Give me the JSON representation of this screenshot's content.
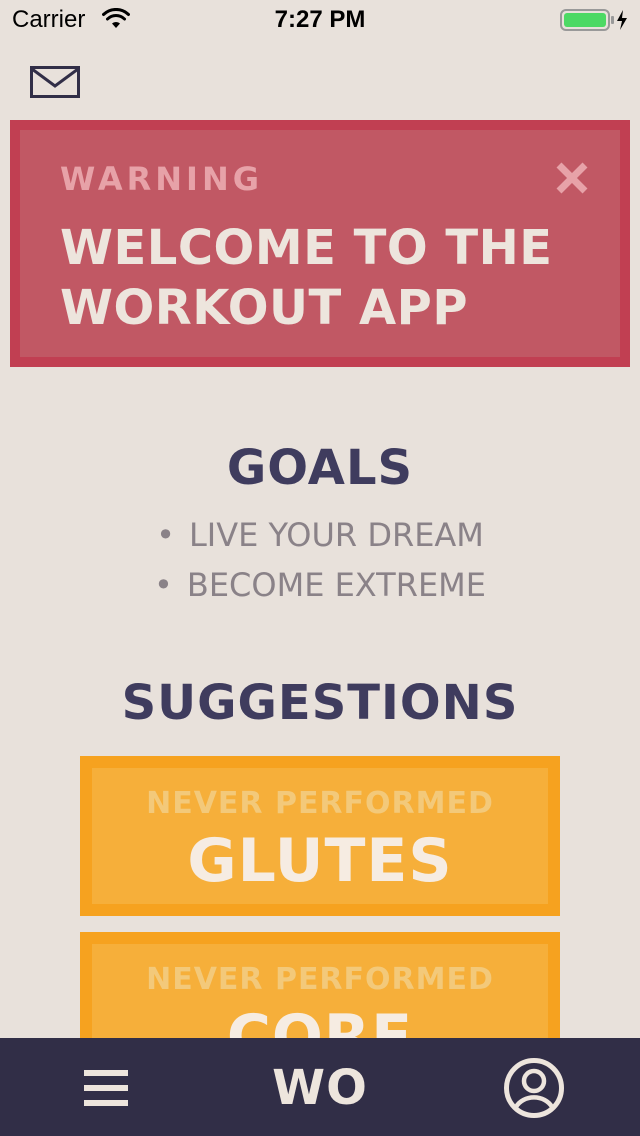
{
  "status_bar": {
    "carrier": "Carrier",
    "time": "7:27 PM"
  },
  "warning": {
    "label": "WARNING",
    "title": "WELCOME TO THE WORKOUT APP"
  },
  "goals": {
    "title": "GOALS",
    "items": [
      "LIVE YOUR DREAM",
      "BECOME EXTREME"
    ]
  },
  "suggestions": {
    "title": "SUGGESTIONS",
    "cards": [
      {
        "subtitle": "NEVER PERFORMED",
        "name": "GLUTES"
      },
      {
        "subtitle": "NEVER PERFORMED",
        "name": "CORE"
      }
    ]
  },
  "tab_bar": {
    "logo": "WO"
  },
  "icons": {
    "mail": "mail-icon",
    "close": "close-icon",
    "menu": "menu-icon",
    "profile": "profile-icon",
    "wifi": "wifi-icon",
    "battery": "battery-icon"
  },
  "colors": {
    "background": "#e8e1db",
    "warning_border": "#c13f52",
    "warning_fill": "#c15864",
    "heading": "#3f3c5e",
    "card_border": "#f6a21f",
    "card_fill": "#f6af3a",
    "tab_bar": "#312e47"
  }
}
